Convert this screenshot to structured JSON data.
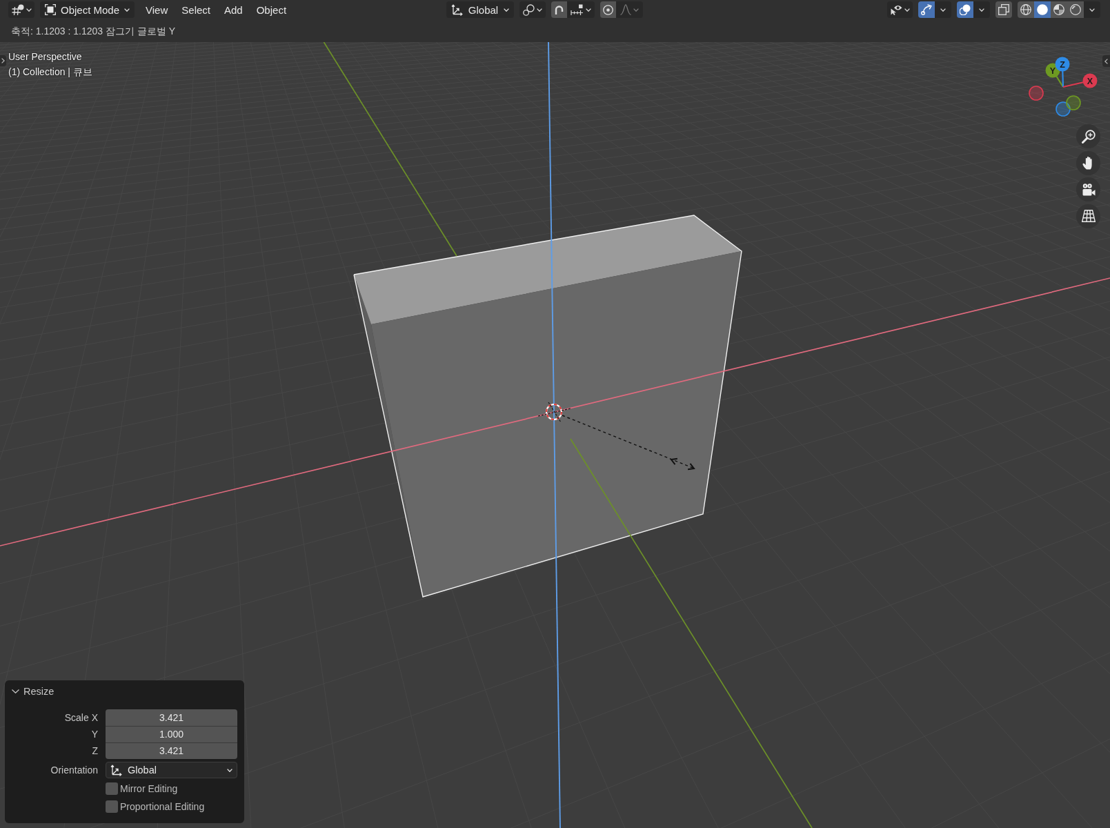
{
  "header": {
    "mode": "Object Mode",
    "menus": [
      "View",
      "Select",
      "Add",
      "Object"
    ],
    "orientation": "Global",
    "snap": {
      "on": false
    },
    "proportional": {
      "on": false
    },
    "falloff": {
      "disabled": true
    },
    "toggles": [
      {
        "kind": "gizmo",
        "on": true
      },
      {
        "kind": "overlay",
        "on": true
      },
      {
        "kind": "xray",
        "on": false
      }
    ],
    "shading": [
      {
        "kind": "wireframe",
        "selected": false
      },
      {
        "kind": "solid",
        "selected": true
      },
      {
        "kind": "material",
        "selected": false
      },
      {
        "kind": "rendered",
        "selected": false
      }
    ]
  },
  "status": "축적: 1.1203 : 1.1203 잠그기 글로벌 Y",
  "viewport": {
    "view": "User Perspective",
    "collection": "(1) Collection | 큐브"
  },
  "gizmo_axes": [
    {
      "label": "X",
      "color": "#dc3a50"
    },
    {
      "label": "Y",
      "color": "#6e9a22"
    },
    {
      "label": "Z",
      "color": "#2e8be6"
    }
  ],
  "panel": {
    "title": "Resize",
    "expanded": true,
    "fields": [
      {
        "label": "Scale X",
        "value": "3.421"
      },
      {
        "label": "Y",
        "value": "1.000"
      },
      {
        "label": "Z",
        "value": "3.421"
      }
    ],
    "orientation": {
      "label": "Orientation",
      "value": "Global"
    },
    "options": [
      {
        "label": "Mirror Editing",
        "checked": false
      },
      {
        "label": "Proportional Editing",
        "checked": false
      }
    ]
  }
}
